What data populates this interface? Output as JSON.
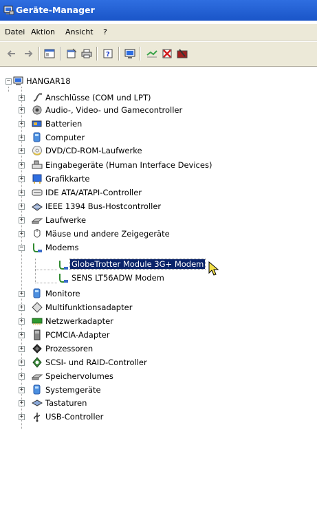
{
  "window": {
    "title": "Geräte-Manager",
    "icon": "device-manager-icon"
  },
  "menu": [
    "Datei",
    "Aktion",
    "Ansicht",
    "?"
  ],
  "toolbar": {
    "buttons": [
      "back-icon",
      "forward-icon",
      "show-hide-console-tree-icon",
      "properties-icon",
      "print-icon",
      "help-icon",
      "scan-hardware-icon",
      "update-driver-icon",
      "disable-device-icon",
      "uninstall-device-icon"
    ]
  },
  "tree": {
    "root": {
      "label": "HANGAR18",
      "icon": "computer-icon"
    },
    "categories": [
      {
        "label": "Anschlüsse (COM und LPT)",
        "icon": "port-icon",
        "expanded": false
      },
      {
        "label": "Audio-, Video- und Gamecontroller",
        "icon": "audio-icon",
        "expanded": false
      },
      {
        "label": "Batterien",
        "icon": "battery-icon",
        "expanded": false
      },
      {
        "label": "Computer",
        "icon": "computer-icon",
        "expanded": false
      },
      {
        "label": "DVD/CD-ROM-Laufwerke",
        "icon": "cdrom-icon",
        "expanded": false
      },
      {
        "label": "Eingabegeräte (Human Interface Devices)",
        "icon": "hid-icon",
        "expanded": false
      },
      {
        "label": "Grafikkarte",
        "icon": "display-adapter-icon",
        "expanded": false
      },
      {
        "label": "IDE ATA/ATAPI-Controller",
        "icon": "ide-icon",
        "expanded": false
      },
      {
        "label": "IEEE 1394 Bus-Hostcontroller",
        "icon": "firewire-icon",
        "expanded": false
      },
      {
        "label": "Laufwerke",
        "icon": "disk-drive-icon",
        "expanded": false
      },
      {
        "label": "Mäuse und andere Zeigegeräte",
        "icon": "mouse-icon",
        "expanded": false
      },
      {
        "label": "Modems",
        "icon": "modem-icon",
        "expanded": true,
        "children": [
          {
            "label": "GlobeTrotter Module 3G+ Modem",
            "icon": "modem-icon",
            "selected": true
          },
          {
            "label": "SENS LT56ADW Modem",
            "icon": "modem-icon",
            "selected": false
          }
        ]
      },
      {
        "label": "Monitore",
        "icon": "monitor-icon",
        "expanded": false
      },
      {
        "label": "Multifunktionsadapter",
        "icon": "multifunction-icon",
        "expanded": false
      },
      {
        "label": "Netzwerkadapter",
        "icon": "network-adapter-icon",
        "expanded": false
      },
      {
        "label": "PCMCIA-Adapter",
        "icon": "pcmcia-icon",
        "expanded": false
      },
      {
        "label": "Prozessoren",
        "icon": "processor-icon",
        "expanded": false
      },
      {
        "label": "SCSI- und RAID-Controller",
        "icon": "scsi-icon",
        "expanded": false
      },
      {
        "label": "Speichervolumes",
        "icon": "storage-volume-icon",
        "expanded": false
      },
      {
        "label": "Systemgeräte",
        "icon": "system-device-icon",
        "expanded": false
      },
      {
        "label": "Tastaturen",
        "icon": "keyboard-icon",
        "expanded": false
      },
      {
        "label": "USB-Controller",
        "icon": "usb-icon",
        "expanded": false
      }
    ]
  },
  "colors": {
    "titlebar": "#1a55c8",
    "selection": "#0a246a",
    "chrome": "#ece9d8"
  }
}
